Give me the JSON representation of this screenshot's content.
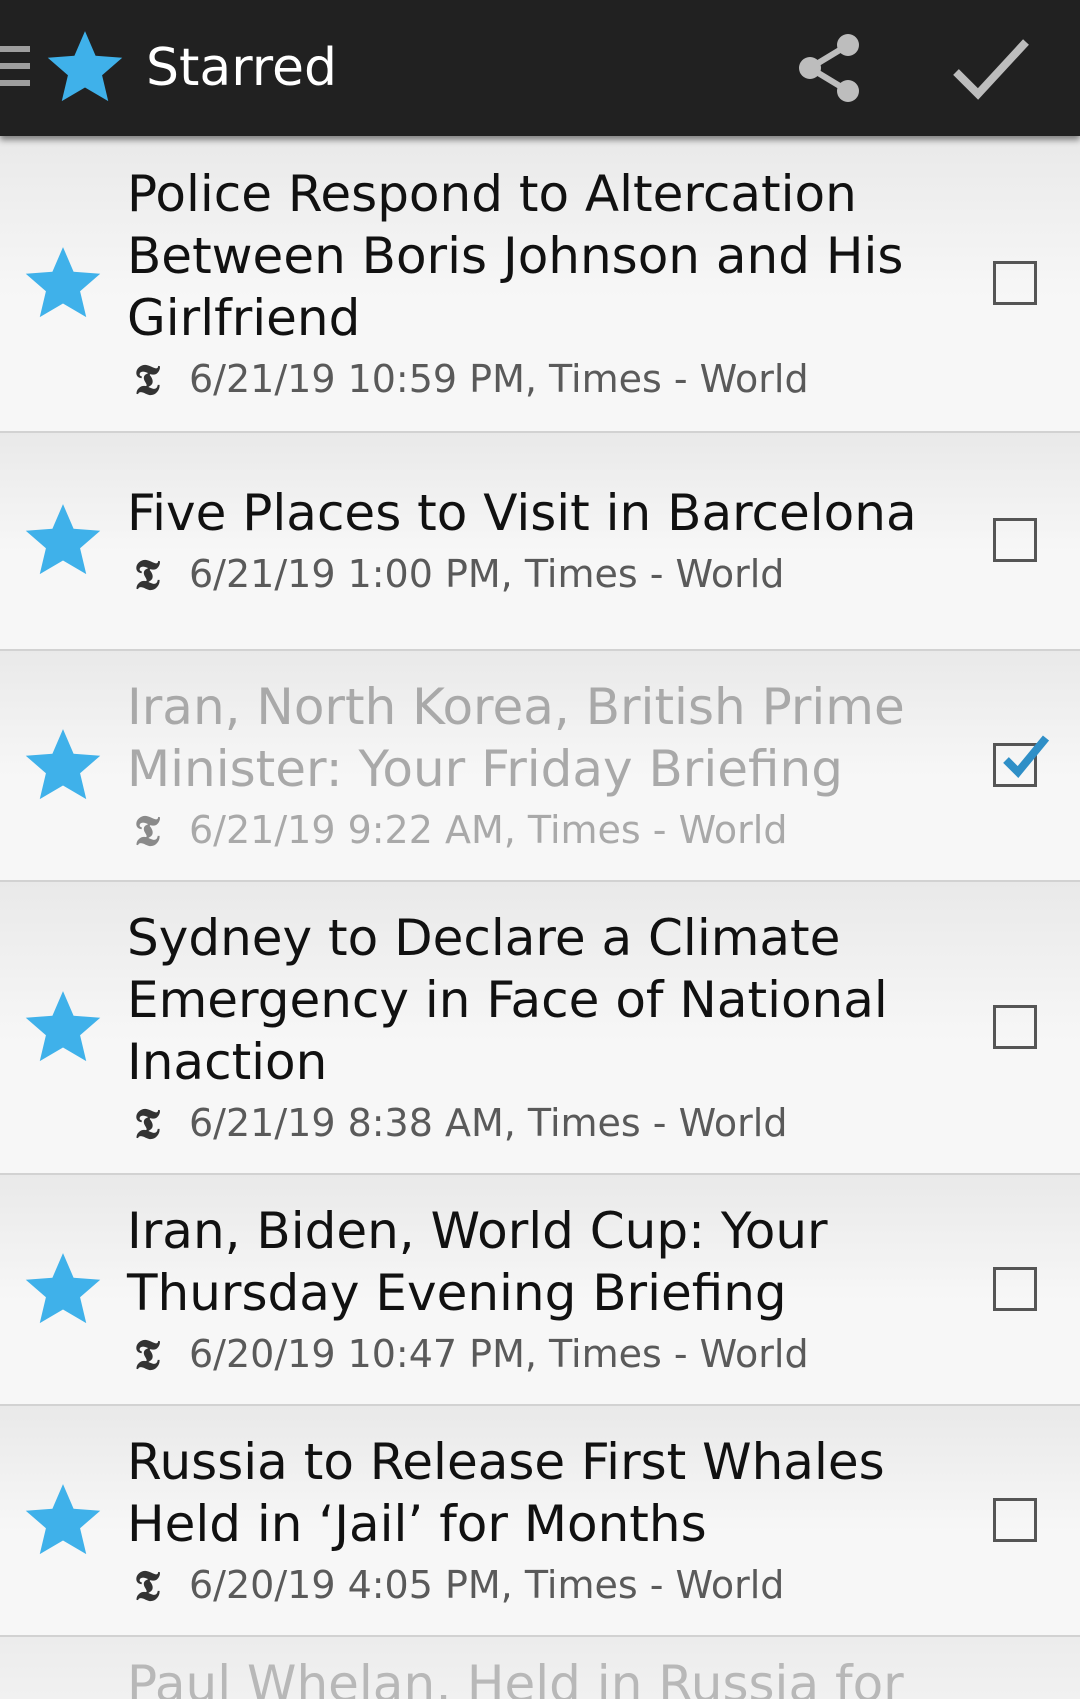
{
  "header": {
    "title": "Starred",
    "menu_icon": "hamburger-menu-icon",
    "app_icon": "star-icon",
    "share_icon": "share-icon",
    "done_icon": "checkmark-icon"
  },
  "colors": {
    "accent_star": "#3fb1ea",
    "topbar": "#212121",
    "checked": "#2f8fc7"
  },
  "articles": [
    {
      "title_lines": [
        "Police Respond to Altercation",
        "Between Boris Johnson and His",
        "Girlfriend"
      ],
      "meta": "6/21/19 10:59 PM, Times - World",
      "checked": false,
      "read": false
    },
    {
      "title_lines": [
        "Five Places to Visit in Barcelona"
      ],
      "meta": "6/21/19 1:00 PM, Times - World",
      "checked": false,
      "read": false
    },
    {
      "title_lines": [
        "Iran, North Korea, British Prime",
        "Minister: Your Friday Briefing"
      ],
      "meta": "6/21/19 9:22 AM, Times - World",
      "checked": true,
      "read": true
    },
    {
      "title_lines": [
        "Sydney to Declare a Climate",
        "Emergency in Face of National",
        "Inaction"
      ],
      "meta": "6/21/19 8:38 AM, Times - World",
      "checked": false,
      "read": false
    },
    {
      "title_lines": [
        "Iran, Biden, World Cup: Your",
        "Thursday Evening Briefing"
      ],
      "meta": "6/20/19 10:47 PM, Times - World",
      "checked": false,
      "read": false
    },
    {
      "title_lines": [
        "Russia to Release First Whales",
        "Held in ‘Jail’ for Months"
      ],
      "meta": "6/20/19 4:05 PM, Times - World",
      "checked": false,
      "read": false
    },
    {
      "title_lines": [
        "Paul Whelan, Held in Russia for"
      ],
      "partial": true
    }
  ],
  "source_icon": {
    "name": "nyt-logo-icon",
    "glyph": "𝕿"
  }
}
